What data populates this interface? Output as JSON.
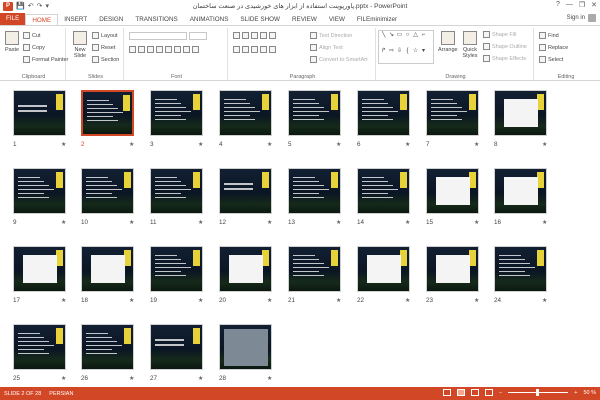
{
  "window": {
    "title": "پاورپوینت استفاده از ابزار های خورشیدی در صنعت ساختمان.pptx - PowerPoint",
    "minimize": "—",
    "restore": "❐",
    "close": "✕",
    "help": "?"
  },
  "qat": {
    "app": "P",
    "save": "💾",
    "undo": "↶",
    "redo": "↷",
    "customize": "▾"
  },
  "tabs": [
    "FILE",
    "HOME",
    "INSERT",
    "DESIGN",
    "TRANSITIONS",
    "ANIMATIONS",
    "SLIDE SHOW",
    "REVIEW",
    "VIEW",
    "FILEminimizer"
  ],
  "active_tab": "HOME",
  "user": {
    "sign_in": "Sign in"
  },
  "ribbon": {
    "clipboard": {
      "label": "Clipboard",
      "paste": "Paste",
      "cut": "Cut",
      "copy": "Copy",
      "format_painter": "Format Painter"
    },
    "slides": {
      "label": "Slides",
      "new_slide": "New Slide",
      "layout": "Layout",
      "reset": "Reset",
      "section": "Section"
    },
    "font": {
      "label": "Font"
    },
    "paragraph": {
      "label": "Paragraph",
      "text_direction": "Text Direction",
      "align_text": "Align Text",
      "convert_smartart": "Convert to SmartArt"
    },
    "drawing": {
      "label": "Drawing",
      "arrange": "Arrange",
      "quick_styles": "Quick Styles",
      "shape_fill": "Shape Fill",
      "shape_outline": "Shape Outline",
      "shape_effects": "Shape Effects"
    },
    "editing": {
      "label": "Editing",
      "find": "Find",
      "replace": "Replace",
      "select": "Select"
    }
  },
  "slides": [
    {
      "num": "1",
      "kind": "title"
    },
    {
      "num": "2",
      "kind": "text",
      "selected": true
    },
    {
      "num": "3",
      "kind": "text"
    },
    {
      "num": "4",
      "kind": "text"
    },
    {
      "num": "5",
      "kind": "text"
    },
    {
      "num": "6",
      "kind": "text"
    },
    {
      "num": "7",
      "kind": "text"
    },
    {
      "num": "8",
      "kind": "figure"
    },
    {
      "num": "9",
      "kind": "text"
    },
    {
      "num": "10",
      "kind": "text"
    },
    {
      "num": "11",
      "kind": "text"
    },
    {
      "num": "12",
      "kind": "title"
    },
    {
      "num": "13",
      "kind": "text"
    },
    {
      "num": "14",
      "kind": "text"
    },
    {
      "num": "15",
      "kind": "figure"
    },
    {
      "num": "16",
      "kind": "figure"
    },
    {
      "num": "17",
      "kind": "figure"
    },
    {
      "num": "18",
      "kind": "figure"
    },
    {
      "num": "19",
      "kind": "text"
    },
    {
      "num": "20",
      "kind": "figure"
    },
    {
      "num": "21",
      "kind": "text"
    },
    {
      "num": "22",
      "kind": "figure"
    },
    {
      "num": "23",
      "kind": "figure"
    },
    {
      "num": "24",
      "kind": "text"
    },
    {
      "num": "25",
      "kind": "text"
    },
    {
      "num": "26",
      "kind": "text"
    },
    {
      "num": "27",
      "kind": "title"
    },
    {
      "num": "28",
      "kind": "photo"
    }
  ],
  "star_glyph": "★",
  "status": {
    "slide_of": "SLIDE 2 OF 28",
    "language": "PERSIAN",
    "zoom": "50 %",
    "minus": "−",
    "plus": "+"
  },
  "colors": {
    "accent": "#d24726",
    "slide_bg": "#0c1420",
    "logo_tag": "#e8d23a"
  }
}
